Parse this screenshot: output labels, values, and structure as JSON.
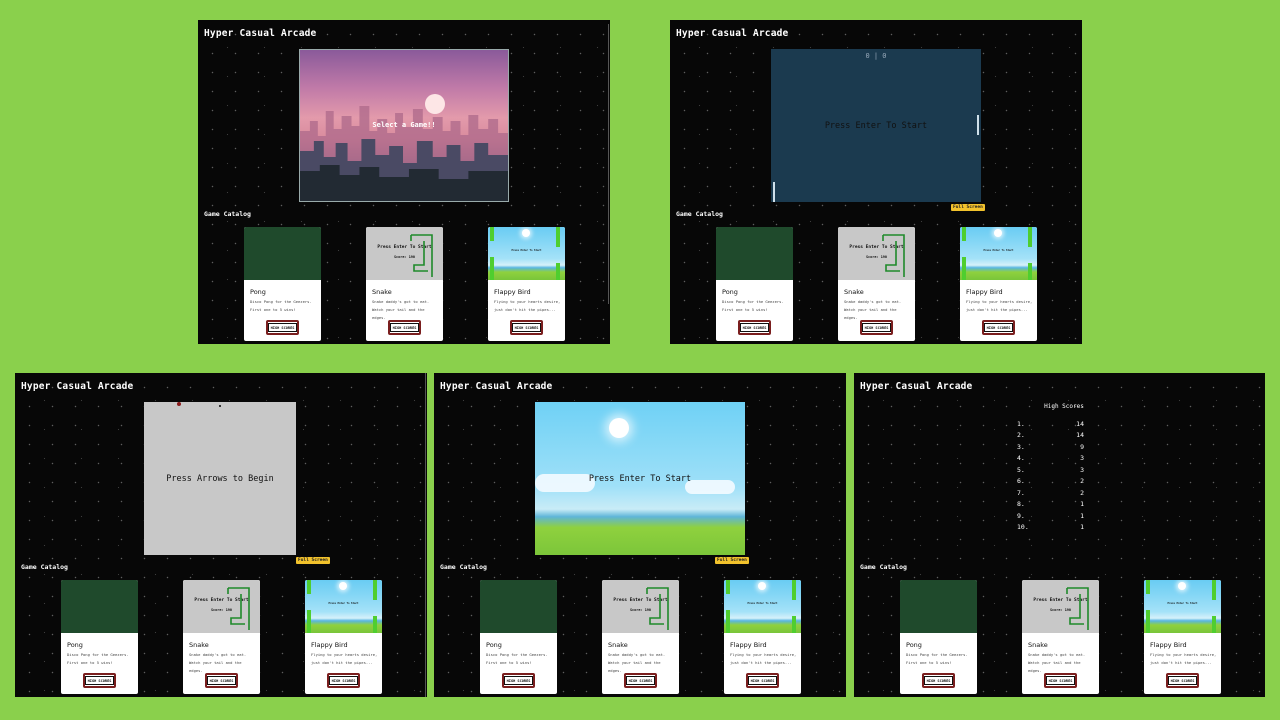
{
  "site_title": "Hyper Casual Arcade",
  "catalog_title": "Game Catalog",
  "fullscreen_label": "Full Screen",
  "stages": {
    "select": "Select a Game!!",
    "pong_start": "Press Enter To Start",
    "pong_score": "0 | 0",
    "snake_start": "Press Arrows to Begin",
    "flappy_start": "Press Enter To Start"
  },
  "games": [
    {
      "title": "Pong",
      "desc": "Disco Pong for the Geezers. First one to 5 wins!",
      "button": "HIGH SCORES"
    },
    {
      "title": "Snake",
      "desc": "Snake daddy's got to eat. Watch your tail and the edges.",
      "button": "HIGH SCORES",
      "thumb_text": "Press Enter To Start",
      "thumb_score": "Score: 190"
    },
    {
      "title": "Flappy Bird",
      "desc": "Flying to your hearts desire, just don't hit the pipes...",
      "button": "HIGH SCORES",
      "thumb_text": "Press Enter To Start"
    }
  ],
  "high_scores": {
    "title": "High Scores",
    "rows": [
      {
        "rank": "1.",
        "score": "14"
      },
      {
        "rank": "2.",
        "score": "14"
      },
      {
        "rank": "3.",
        "score": "9"
      },
      {
        "rank": "4.",
        "score": "3"
      },
      {
        "rank": "5.",
        "score": "3"
      },
      {
        "rank": "6.",
        "score": "2"
      },
      {
        "rank": "7.",
        "score": "2"
      },
      {
        "rank": "8.",
        "score": "1"
      },
      {
        "rank": "9.",
        "score": "1"
      },
      {
        "rank": "10.",
        "score": "1"
      }
    ]
  },
  "colors": {
    "background": "#8ad04c",
    "panel": "#070707",
    "fullscreen_button": "#f2c22c",
    "pong_stage": "#1b3a4f"
  }
}
